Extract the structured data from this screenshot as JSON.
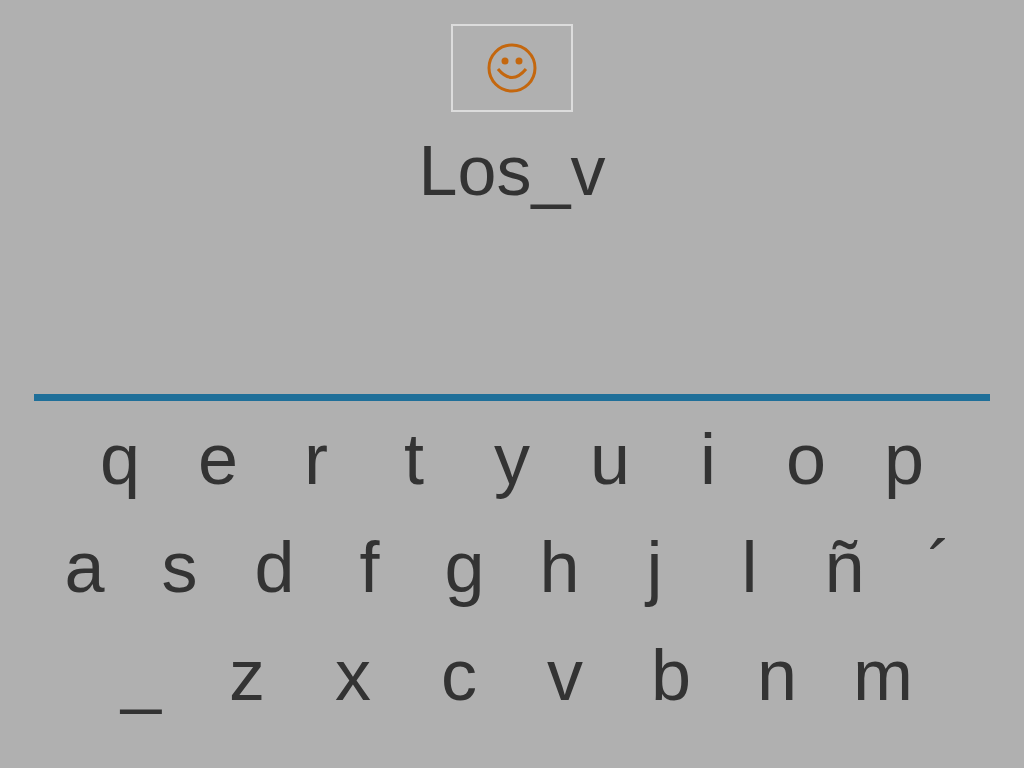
{
  "typed_text": "Los_v",
  "keyboard": {
    "rows": [
      [
        "q",
        "e",
        "r",
        "t",
        "y",
        "u",
        "i",
        "o",
        "p"
      ],
      [
        "a",
        "s",
        "d",
        "f",
        "g",
        "h",
        "j",
        "l",
        "ñ",
        "´"
      ],
      [
        "_",
        "z",
        "x",
        "c",
        "v",
        "b",
        "n",
        "m"
      ]
    ]
  }
}
